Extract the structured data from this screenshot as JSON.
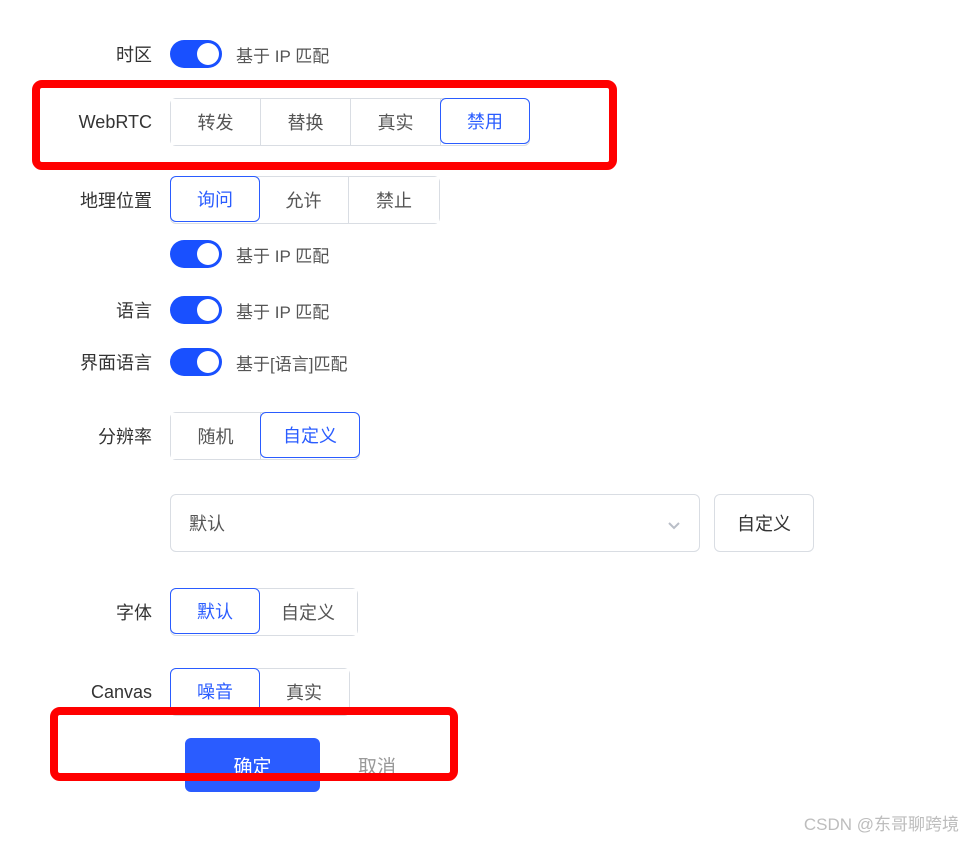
{
  "timezone": {
    "label": "时区",
    "toggle_label": "基于 IP 匹配"
  },
  "webrtc": {
    "label": "WebRTC",
    "options": [
      "转发",
      "替换",
      "真实",
      "禁用"
    ],
    "selected": 3
  },
  "geolocation": {
    "label": "地理位置",
    "options": [
      "询问",
      "允许",
      "禁止"
    ],
    "selected": 0,
    "toggle_label": "基于 IP 匹配"
  },
  "language": {
    "label": "语言",
    "toggle_label": "基于 IP 匹配"
  },
  "ui_language": {
    "label": "界面语言",
    "toggle_label": "基于[语言]匹配"
  },
  "resolution": {
    "label": "分辨率",
    "options": [
      "随机",
      "自定义"
    ],
    "selected": 1,
    "select_value": "默认",
    "custom_button": "自定义"
  },
  "font": {
    "label": "字体",
    "options": [
      "默认",
      "自定义"
    ],
    "selected": 0
  },
  "canvas": {
    "label": "Canvas",
    "options": [
      "噪音",
      "真实"
    ],
    "selected": 0
  },
  "actions": {
    "ok": "确定",
    "cancel": "取消"
  },
  "watermark": "CSDN @东哥聊跨境"
}
